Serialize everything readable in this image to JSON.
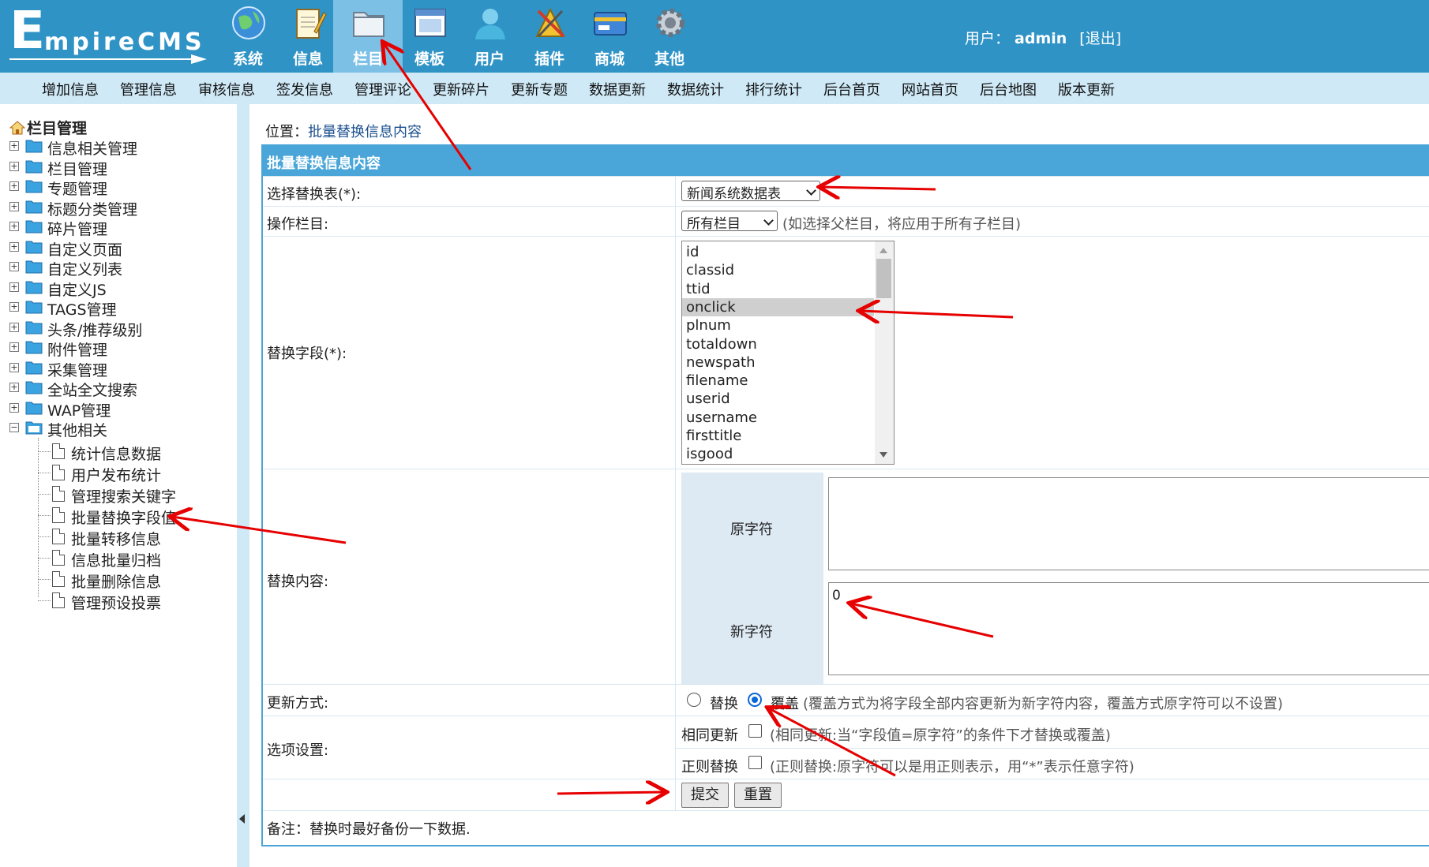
{
  "header": {
    "logo_text": "EmpireCMS",
    "nav": [
      {
        "label": "系统",
        "icon": "globe-icon"
      },
      {
        "label": "信息",
        "icon": "notepad-icon"
      },
      {
        "label": "栏目",
        "icon": "folder-icon"
      },
      {
        "label": "模板",
        "icon": "window-icon"
      },
      {
        "label": "用户",
        "icon": "user-icon"
      },
      {
        "label": "插件",
        "icon": "tools-icon"
      },
      {
        "label": "商城",
        "icon": "card-icon"
      },
      {
        "label": "其他",
        "icon": "gear-icon"
      }
    ],
    "active_nav": "栏目",
    "user_label": "用户：",
    "username": "admin",
    "logout": "[退出]"
  },
  "submenu": [
    "增加信息",
    "管理信息",
    "审核信息",
    "签发信息",
    "管理评论",
    "更新碎片",
    "更新专题",
    "数据更新",
    "数据统计",
    "排行统计",
    "后台首页",
    "网站首页",
    "后台地图",
    "版本更新"
  ],
  "sidebar": {
    "root": "栏目管理",
    "nodes": [
      "信息相关管理",
      "栏目管理",
      "专题管理",
      "标题分类管理",
      "碎片管理",
      "自定义页面",
      "自定义列表",
      "自定义JS",
      "TAGS管理",
      "头条/推荐级别",
      "附件管理",
      "采集管理",
      "全站全文搜索",
      "WAP管理",
      "其他相关"
    ],
    "leaves": [
      "统计信息数据",
      "用户发布统计",
      "管理搜索关键字",
      "批量替换字段值",
      "批量转移信息",
      "信息批量归档",
      "批量删除信息",
      "管理预设投票"
    ]
  },
  "main": {
    "location_label": "位置：",
    "location_link": "批量替换信息内容",
    "form_title": "批量替换信息内容",
    "table_label": "选择替换表(*):",
    "table_value": "新闻系统数据表",
    "class_label": "操作栏目:",
    "class_value": "所有栏目",
    "class_hint": "(如选择父栏目，将应用于所有子栏目)",
    "field_label": "替换字段(*):",
    "fields": [
      "id",
      "classid",
      "ttid",
      "onclick",
      "plnum",
      "totaldown",
      "newspath",
      "filename",
      "userid",
      "username",
      "firsttitle",
      "isgood"
    ],
    "selected_field": "onclick",
    "content_label": "替换内容:",
    "old_char_label": "原字符",
    "old_char_value": "",
    "new_char_label": "新字符",
    "new_char_value": "0",
    "mode_label": "更新方式:",
    "mode_replace": "替换",
    "mode_cover": "覆盖",
    "mode_selected": "覆盖",
    "mode_hint": "(覆盖方式为将字段全部内容更新为新字符内容，覆盖方式原字符可以不设置)",
    "options_label": "选项设置:",
    "opt_same_label": "相同更新",
    "opt_same_hint": "(相同更新:当“字段值=原字符”的条件下才替换或覆盖)",
    "opt_regex_label": "正则替换",
    "opt_regex_hint": "(正则替换:原字符可以是用正则表示，用“*”表示任意字符)",
    "submit": "提交",
    "reset": "重置",
    "note": "备注：替换时最好备份一下数据."
  },
  "colors": {
    "header_bg": "#2f93c6",
    "submenu_bg": "#cfe9f7",
    "form_header_bg": "#4aa6d8",
    "annotation_arrow": "#e60000"
  }
}
